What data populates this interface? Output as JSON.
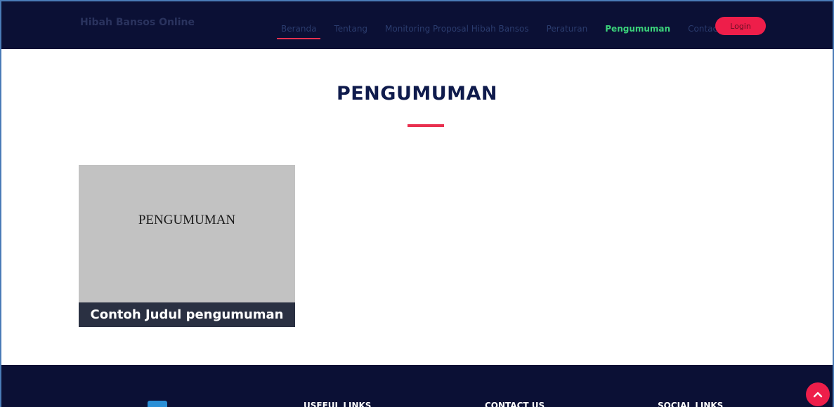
{
  "header": {
    "brand": "Hibah Bansos Online",
    "nav": [
      {
        "label": "Beranda"
      },
      {
        "label": "Tentang"
      },
      {
        "label": "Monitoring Proposal Hibah Bansos"
      },
      {
        "label": "Peraturan"
      },
      {
        "label": "Pengumuman"
      },
      {
        "label": "Contact"
      }
    ],
    "active_item": "Pengumuman",
    "login_label": "Login"
  },
  "main": {
    "title": "PENGUMUMAN",
    "cards": [
      {
        "image_text": "PENGUMUMAN",
        "caption": "Contoh Judul pengumuman"
      }
    ]
  },
  "footer": {
    "headings": [
      "USEFUL LINKS",
      "CONTACT US",
      "SOCIAL LINKS"
    ],
    "icons": {
      "logo": "app-logo",
      "to_top": "chevron-up-icon"
    }
  },
  "colors": {
    "navbar_bg": "#0b1035",
    "accent": "#e9304f",
    "active_nav": "#3bd37b",
    "login_bg": "#ee1e4a",
    "title": "#0f1b4c"
  }
}
